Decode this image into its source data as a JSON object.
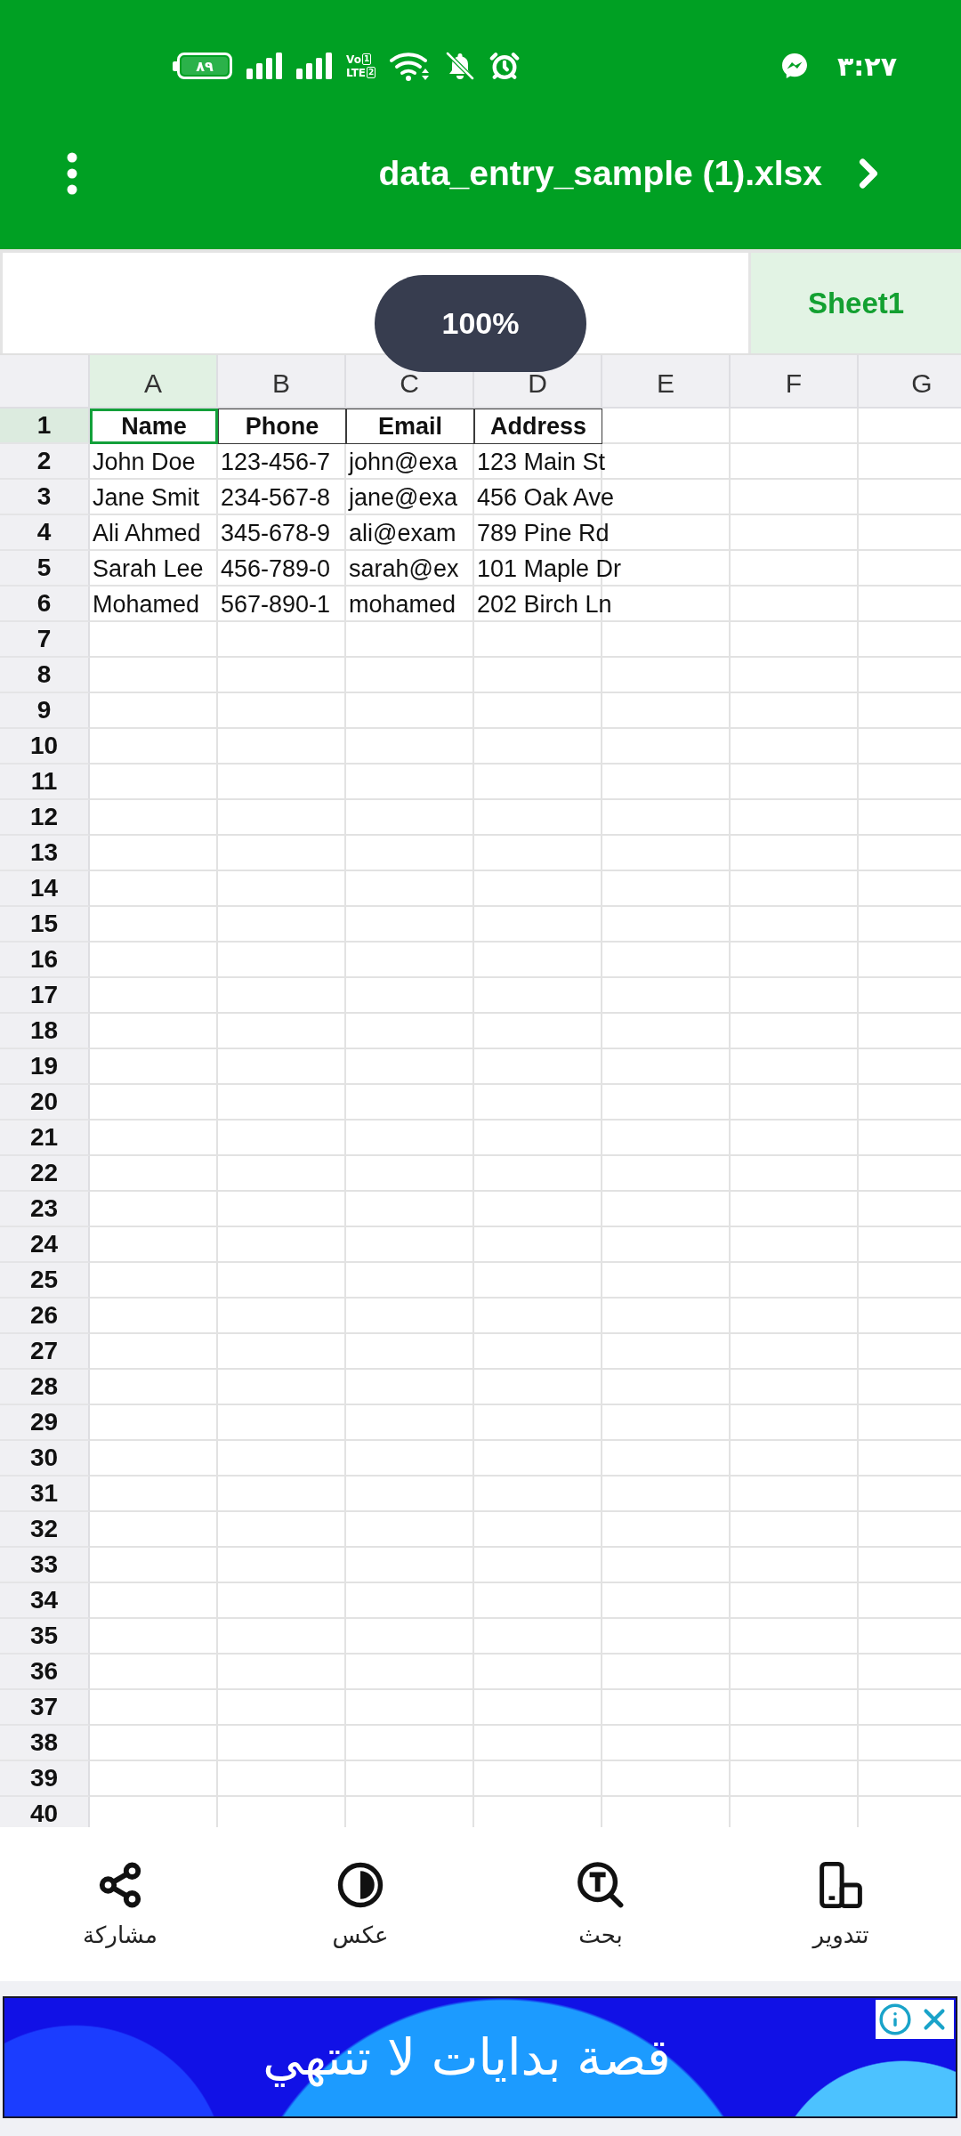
{
  "status_bar": {
    "battery_text": "٨٩",
    "network_badge": {
      "top": "Vo",
      "top_sim": "1",
      "bottom": "LTE",
      "bottom_sim": "2"
    },
    "time": "٣:٢٧"
  },
  "title_bar": {
    "title": "data_entry_sample (1).xlsx"
  },
  "sheet_tabs": [
    {
      "label": "Sheet1",
      "selected": true
    }
  ],
  "zoom_badge": {
    "label": "100%"
  },
  "grid": {
    "columns": [
      {
        "label": "A",
        "selected": true
      },
      {
        "label": "B",
        "selected": false
      },
      {
        "label": "C",
        "selected": false
      },
      {
        "label": "D",
        "selected": false
      },
      {
        "label": "E",
        "selected": false
      },
      {
        "label": "F",
        "selected": false
      },
      {
        "label": "G",
        "selected": false
      }
    ],
    "rows": [
      {
        "number": "1",
        "kind": "header",
        "selected": true,
        "cells": [
          "Name",
          "Phone",
          "Email",
          "Address"
        ]
      },
      {
        "number": "2",
        "kind": "data",
        "selected": false,
        "cells": [
          "John Doe",
          "123-456-7",
          "john@exa",
          "123 Main St"
        ]
      },
      {
        "number": "3",
        "kind": "data",
        "selected": false,
        "cells": [
          "Jane Smit",
          "234-567-8",
          "jane@exa",
          "456 Oak Ave"
        ]
      },
      {
        "number": "4",
        "kind": "data",
        "selected": false,
        "cells": [
          "Ali Ahmed",
          "345-678-9",
          "ali@exam",
          "789 Pine Rd"
        ]
      },
      {
        "number": "5",
        "kind": "data",
        "selected": false,
        "cells": [
          "Sarah Lee",
          "456-789-0",
          "sarah@ex",
          "101 Maple Dr"
        ]
      },
      {
        "number": "6",
        "kind": "data",
        "selected": false,
        "cells": [
          "Mohamed",
          "567-890-1",
          "mohamed",
          "202 Birch Ln"
        ]
      },
      {
        "number": "7",
        "kind": "data",
        "selected": false
      },
      {
        "number": "8",
        "kind": "data",
        "selected": false
      },
      {
        "number": "9",
        "kind": "data",
        "selected": false
      },
      {
        "number": "10",
        "kind": "data",
        "selected": false
      },
      {
        "number": "11",
        "kind": "data",
        "selected": false
      },
      {
        "number": "12",
        "kind": "data",
        "selected": false
      },
      {
        "number": "13",
        "kind": "data",
        "selected": false
      },
      {
        "number": "14",
        "kind": "data",
        "selected": false
      },
      {
        "number": "15",
        "kind": "data",
        "selected": false
      },
      {
        "number": "16",
        "kind": "data",
        "selected": false
      },
      {
        "number": "17",
        "kind": "data",
        "selected": false
      },
      {
        "number": "18",
        "kind": "data",
        "selected": false
      },
      {
        "number": "19",
        "kind": "data",
        "selected": false
      },
      {
        "number": "20",
        "kind": "data",
        "selected": false
      },
      {
        "number": "21",
        "kind": "data",
        "selected": false
      },
      {
        "number": "22",
        "kind": "data",
        "selected": false
      },
      {
        "number": "23",
        "kind": "data",
        "selected": false
      },
      {
        "number": "24",
        "kind": "data",
        "selected": false
      },
      {
        "number": "25",
        "kind": "data",
        "selected": false
      },
      {
        "number": "26",
        "kind": "data",
        "selected": false
      },
      {
        "number": "27",
        "kind": "data",
        "selected": false
      },
      {
        "number": "28",
        "kind": "data",
        "selected": false
      },
      {
        "number": "29",
        "kind": "data",
        "selected": false
      },
      {
        "number": "30",
        "kind": "data",
        "selected": false
      },
      {
        "number": "31",
        "kind": "data",
        "selected": false
      },
      {
        "number": "32",
        "kind": "data",
        "selected": false
      },
      {
        "number": "33",
        "kind": "data",
        "selected": false
      },
      {
        "number": "34",
        "kind": "data",
        "selected": false
      },
      {
        "number": "35",
        "kind": "data",
        "selected": false
      },
      {
        "number": "36",
        "kind": "data",
        "selected": false
      },
      {
        "number": "37",
        "kind": "data",
        "selected": false
      },
      {
        "number": "38",
        "kind": "data",
        "selected": false
      },
      {
        "number": "39",
        "kind": "data",
        "selected": false
      },
      {
        "number": "40",
        "kind": "data",
        "selected": false
      }
    ]
  },
  "toolbar": [
    {
      "label": "تتدوير"
    },
    {
      "label": "بحث"
    },
    {
      "label": "عكس"
    },
    {
      "label": "مشاركة"
    }
  ],
  "ad": {
    "text": "قصة بدايات لا تنتهي"
  }
}
